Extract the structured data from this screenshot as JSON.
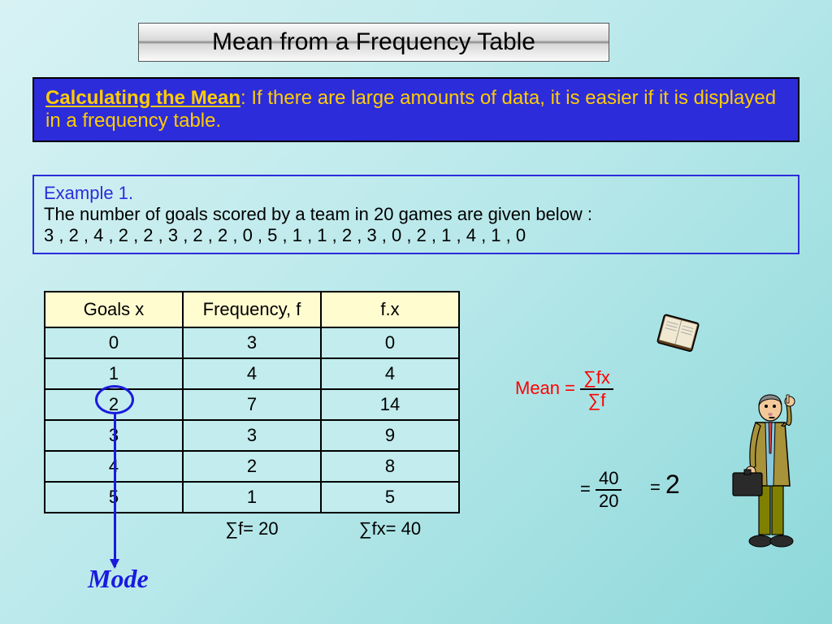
{
  "title": "Mean from a Frequency Table",
  "blueBox": {
    "heading": "Calculating the Mean",
    "text": ": If there are large amounts of data, it is easier if it is displayed in a frequency table."
  },
  "example": {
    "title": "Example 1.",
    "line1": "The number of goals scored by a team in 20 games are given below :",
    "data": "3 , 2 , 4 , 2 , 2 , 3 , 2 , 2 , 0 , 5 , 1 , 1 , 2 , 3 , 0 , 2 , 1 , 4 , 1 , 0"
  },
  "table": {
    "headers": {
      "goals": "Goals  x",
      "freq": "Frequency, f",
      "fx": "f.x"
    },
    "rows": [
      {
        "x": "0",
        "f": "3",
        "fx": "0"
      },
      {
        "x": "1",
        "f": "4",
        "fx": "4"
      },
      {
        "x": "2",
        "f": "7",
        "fx": "14"
      },
      {
        "x": "3",
        "f": "3",
        "fx": "9"
      },
      {
        "x": "4",
        "f": "2",
        "fx": "8"
      },
      {
        "x": "5",
        "f": "1",
        "fx": "5"
      }
    ],
    "totals": {
      "sumf": "∑f= 20",
      "sumfx": "∑fx= 40"
    }
  },
  "mode": "Mode",
  "mean": {
    "label": "Mean = ",
    "num": "∑fx",
    "den": "∑f",
    "eq2num": "40",
    "eq2den": "20",
    "result": "2"
  },
  "chart_data": {
    "type": "table",
    "title": "Frequency table of goals scored in 20 games",
    "columns": [
      "Goals x",
      "Frequency f",
      "f·x"
    ],
    "rows": [
      [
        0,
        3,
        0
      ],
      [
        1,
        4,
        4
      ],
      [
        2,
        7,
        14
      ],
      [
        3,
        3,
        9
      ],
      [
        4,
        2,
        8
      ],
      [
        5,
        1,
        5
      ]
    ],
    "totals": {
      "sum_f": 20,
      "sum_fx": 40
    },
    "mean": 2,
    "mode": 2
  }
}
